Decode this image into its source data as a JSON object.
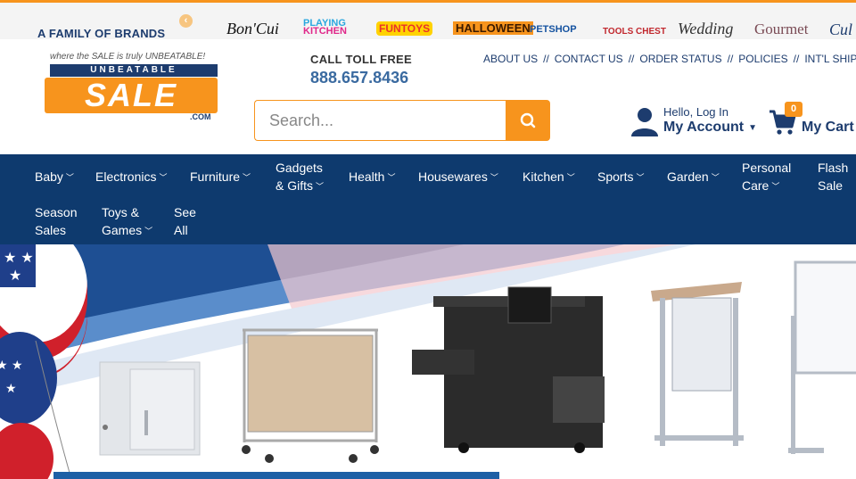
{
  "brand_strip": {
    "family_label": "A FAMILY OF BRANDS",
    "brands": [
      "Bon'Cui",
      "PLAYING",
      "KITCHEN",
      "FUNTOYS",
      "HALLOWEEN",
      "PETSHOP",
      "TOOLS CHEST",
      "Wedding",
      "Gourmet",
      "Cul"
    ]
  },
  "logo": {
    "tagline": "where the SALE is truly UNBEATABLE!",
    "top_word": "UNBEATABLE",
    "main_word": "SALE",
    "suffix": ".COM"
  },
  "contact": {
    "label": "CALL TOLL FREE",
    "phone": "888.657.8436"
  },
  "top_links": [
    "ABOUT US",
    "CONTACT US",
    "ORDER STATUS",
    "POLICIES",
    "INT'L SHIPPI"
  ],
  "top_links_separator": "//",
  "search": {
    "placeholder": "Search..."
  },
  "account": {
    "greeting": "Hello, Log In",
    "label": "My Account"
  },
  "cart": {
    "count": "0",
    "label": "My Cart"
  },
  "nav": {
    "items": [
      {
        "label": "Baby"
      },
      {
        "label": "Electronics"
      },
      {
        "label": "Furniture"
      },
      {
        "label": "Gadgets",
        "label2": "& Gifts"
      },
      {
        "label": "Health"
      },
      {
        "label": "Housewares"
      },
      {
        "label": "Kitchen"
      },
      {
        "label": "Sports"
      },
      {
        "label": "Garden"
      },
      {
        "label": "Personal",
        "label2": "Care"
      },
      {
        "label": "Flash",
        "label2": "Sale"
      },
      {
        "label": "Season",
        "label2": "Sales"
      },
      {
        "label": "Toys &",
        "label2": "Games"
      },
      {
        "label": "See",
        "label2": "All"
      }
    ]
  },
  "colors": {
    "brand_orange": "#f7941d",
    "navy": "#0e3a6e",
    "link_blue": "#1d3c6e"
  },
  "hero": {
    "products": [
      "wall-cabinet",
      "laundry-cart",
      "av-cart",
      "lectern",
      "whiteboard"
    ]
  }
}
